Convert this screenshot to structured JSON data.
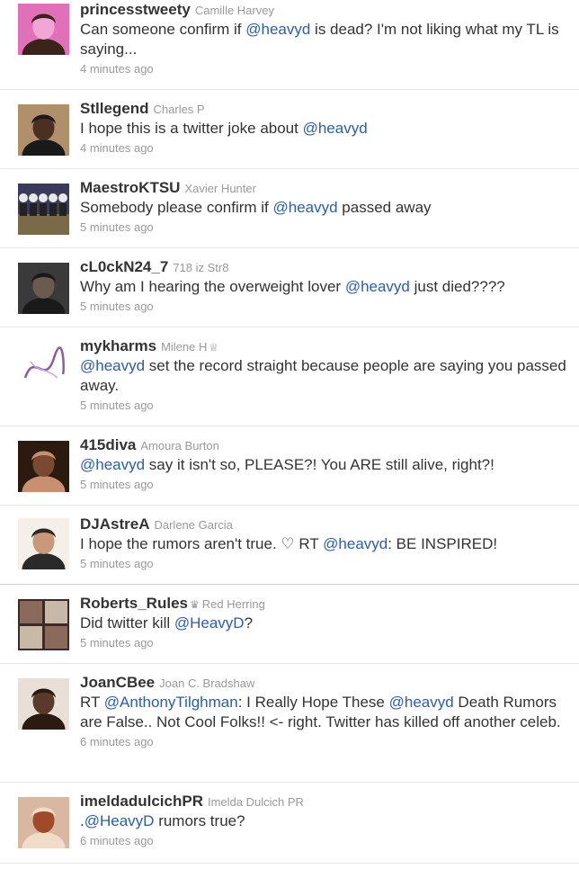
{
  "tweets": [
    {
      "username": "princesstweety",
      "fullname": "Camille Harvey",
      "avatar_icon": "avatar-photo-woman-pink",
      "avatar_colors": [
        "#e070b8",
        "#f2a6d6",
        "#3a2418"
      ],
      "text": [
        {
          "t": "Can someone confirm if "
        },
        {
          "m": "@heavyd"
        },
        {
          "t": " is dead? I'm not liking what my TL is saying..."
        }
      ],
      "time": "4 minutes ago"
    },
    {
      "username": "Stllegend",
      "fullname": "Charles P",
      "avatar_icon": "avatar-photo-man-glasses",
      "avatar_colors": [
        "#b0906a",
        "#4a3020",
        "#1a1a1a"
      ],
      "text": [
        {
          "t": "I hope this is a twitter joke about "
        },
        {
          "m": "@heavyd"
        }
      ],
      "time": "4 minutes ago"
    },
    {
      "username": "MaestroKTSU",
      "fullname": "Xavier Hunter",
      "avatar_icon": "avatar-photo-marching-band",
      "avatar_colors": [
        "#3a3a5a",
        "#e8e8e8",
        "#7a6a4a"
      ],
      "text": [
        {
          "t": "Somebody please confirm if "
        },
        {
          "m": "@heavyd"
        },
        {
          "t": " passed away"
        }
      ],
      "time": "5 minutes ago"
    },
    {
      "username": "cL0ckN24_7",
      "fullname": "718 iz Str8",
      "avatar_icon": "avatar-photo-dark-couple",
      "avatar_colors": [
        "#3a3a3a",
        "#6a5a50",
        "#1a1a1a"
      ],
      "text": [
        {
          "t": "Why am I hearing the overweight lover "
        },
        {
          "m": "@heavyd"
        },
        {
          "t": " just died????"
        }
      ],
      "time": "5 minutes ago"
    },
    {
      "username": "mykharms",
      "fullname": "Milene H",
      "badge": "♕",
      "avatar_icon": "avatar-script-logo-purple",
      "avatar_colors": [
        "#ffffff",
        "#8a5aa8",
        "#c8a8d8"
      ],
      "text": [
        {
          "m": "@heavyd"
        },
        {
          "t": " set the record straight because people are saying you passed away."
        }
      ],
      "time": "5 minutes ago"
    },
    {
      "username": "415diva",
      "fullname": "Amoura Burton",
      "avatar_icon": "avatar-photo-woman-closeup",
      "avatar_colors": [
        "#2a1a10",
        "#7a4a30",
        "#c89070"
      ],
      "text": [
        {
          "m": "@heavyd"
        },
        {
          "t": " say it isn't so, PLEASE?! You ARE still alive, right?!"
        }
      ],
      "time": "5 minutes ago"
    },
    {
      "username": "DJAstreA",
      "fullname": "Darlene Garcia",
      "avatar_icon": "avatar-photo-woman-posing",
      "avatar_colors": [
        "#f4efe8",
        "#c89878",
        "#2a2a2a"
      ],
      "text": [
        {
          "t": "I hope the rumors aren't true. ♡ RT "
        },
        {
          "m": "@heavyd"
        },
        {
          "t": ": BE INSPIRED!"
        }
      ],
      "time": "5 minutes ago"
    },
    {
      "username": "Roberts_Rules",
      "fullname": "Red Herring",
      "badge": "♛",
      "badge_before": true,
      "avatar_icon": "avatar-photo-collage",
      "avatar_colors": [
        "#3a2a2a",
        "#8a6a5a",
        "#c8b8a8"
      ],
      "text": [
        {
          "t": "Did twitter kill "
        },
        {
          "m": "@HeavyD"
        },
        {
          "t": "?"
        }
      ],
      "time": "5 minutes ago"
    },
    {
      "username": "JoanCBee",
      "fullname": "Joan C. Bradshaw",
      "avatar_icon": "avatar-photo-woman-selfie",
      "avatar_colors": [
        "#e8e0d8",
        "#5a3a2a",
        "#2a1a10"
      ],
      "text": [
        {
          "t": "RT "
        },
        {
          "m": "@AnthonyTilghman"
        },
        {
          "t": ": I Really Hope These "
        },
        {
          "m": "@heavyd"
        },
        {
          "t": " Death Rumors are False.. Not Cool Folks!! <- right. Twitter has killed off another celeb."
        }
      ],
      "time": "6 minutes ago"
    },
    {
      "username": "imeldadulcichPR",
      "fullname": "Imelda Dulcich PR",
      "avatar_icon": "avatar-photo-woman-redhair",
      "avatar_colors": [
        "#d8b8a0",
        "#a04a2a",
        "#f0dcc8"
      ],
      "text": [
        {
          "t": "."
        },
        {
          "m": "@HeavyD"
        },
        {
          "t": " rumors true?"
        }
      ],
      "time": "6 minutes ago"
    }
  ]
}
